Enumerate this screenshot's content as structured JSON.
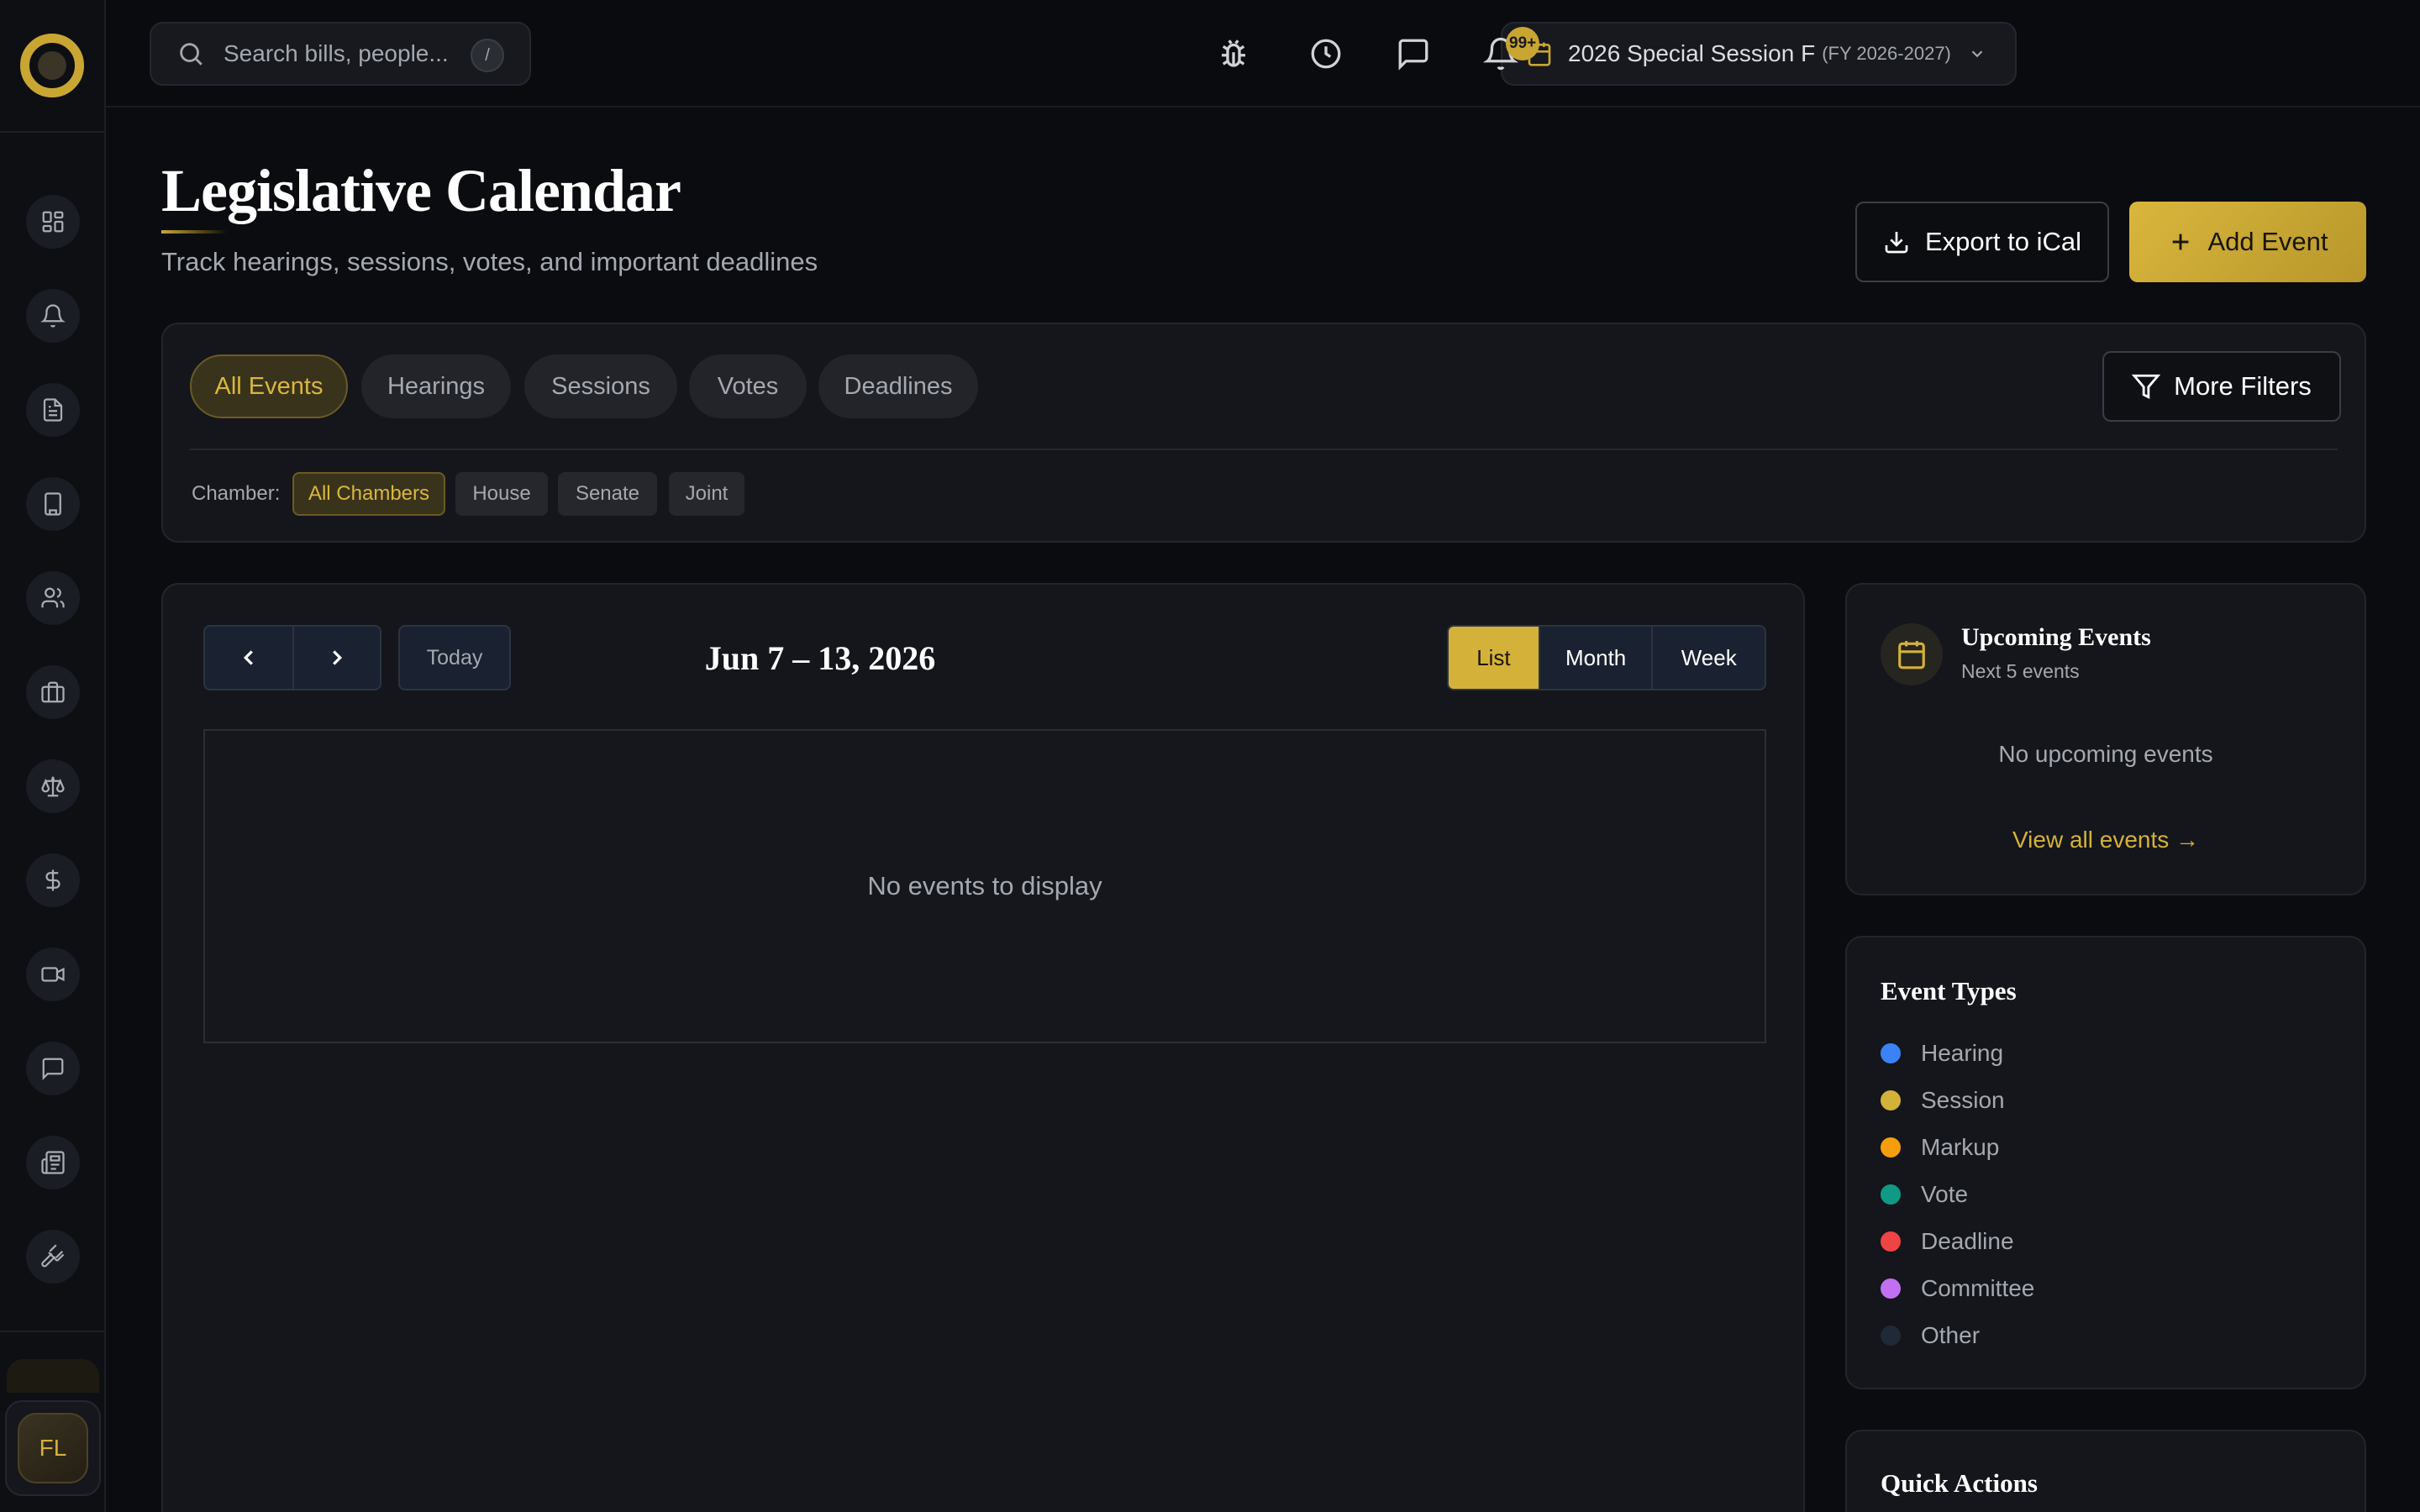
{
  "sidebar": {
    "nav_icons": [
      "dashboard-icon",
      "bell-icon",
      "document-icon",
      "building-icon",
      "users-icon",
      "briefcase-icon",
      "scale-icon",
      "dollar-icon",
      "video-icon",
      "message-icon",
      "newspaper-icon",
      "gavel-icon"
    ],
    "user_initials": "FL"
  },
  "topbar": {
    "search_placeholder": "Search bills, people...",
    "search_shortcut": "/",
    "session_name": "2026 Special Session F",
    "session_fy": "(FY 2026-2027)",
    "notifications_count": "99+"
  },
  "header": {
    "title": "Legislative Calendar",
    "subtitle": "Track hearings, sessions, votes, and important deadlines",
    "export_label": "Export to iCal",
    "add_label": "Add Event"
  },
  "filters": {
    "tabs": [
      "All Events",
      "Hearings",
      "Sessions",
      "Votes",
      "Deadlines"
    ],
    "active_tab": "All Events",
    "more_filters_label": "More Filters",
    "chamber_label": "Chamber:",
    "chambers": [
      "All Chambers",
      "House",
      "Senate",
      "Joint"
    ],
    "active_chamber": "All Chambers"
  },
  "calendar": {
    "today_label": "Today",
    "range": "Jun 7 – 13, 2026",
    "views": [
      "List",
      "Month",
      "Week"
    ],
    "active_view": "List",
    "empty_text": "No events to display"
  },
  "upcoming": {
    "title": "Upcoming Events",
    "subtitle": "Next 5 events",
    "empty_text": "No upcoming events",
    "view_all": "View all events →"
  },
  "event_types": {
    "title": "Event Types",
    "items": [
      {
        "label": "Hearing",
        "color": "#3b82f6"
      },
      {
        "label": "Session",
        "color": "#d4b23a"
      },
      {
        "label": "Markup",
        "color": "#f59e0b"
      },
      {
        "label": "Vote",
        "color": "#0f9a86"
      },
      {
        "label": "Deadline",
        "color": "#ef4444"
      },
      {
        "label": "Committee",
        "color": "#c070f0"
      },
      {
        "label": "Other",
        "color": "#1f2937"
      }
    ]
  },
  "quick_actions": {
    "title": "Quick Actions"
  },
  "colors": {
    "accent": "#d4b23a",
    "background": "#0b0c0f",
    "card": "#14161b"
  }
}
